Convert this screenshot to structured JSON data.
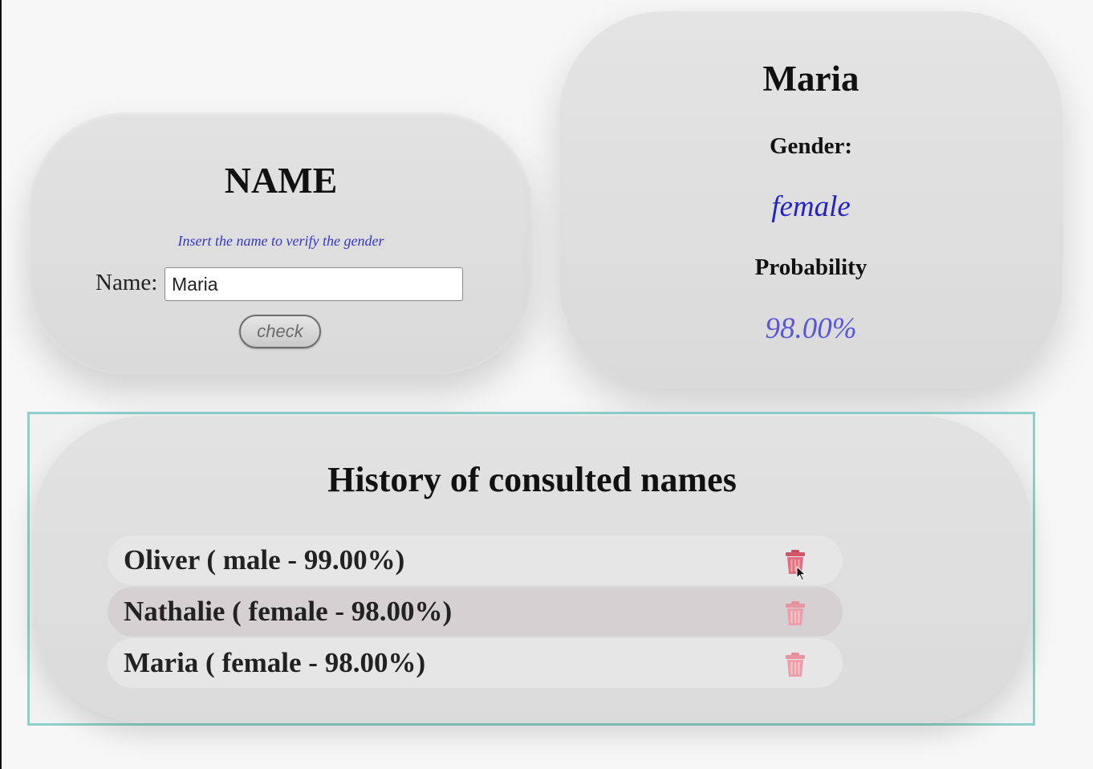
{
  "name_form": {
    "title": "NAME",
    "hint": "Insert the name to verify the gender",
    "label": "Name:",
    "input_value": "Maria",
    "button_label": "check"
  },
  "result": {
    "name": "Maria",
    "gender_label": "Gender:",
    "gender": "female",
    "probability_label": "Probability",
    "probability": "98.00%"
  },
  "history": {
    "title": "History of consulted names",
    "items": [
      {
        "text": "Oliver ( male - 99.00%)",
        "icon": "trash-icon"
      },
      {
        "text": "Nathalie ( female - 98.00%)",
        "icon": "trash-icon"
      },
      {
        "text": "Maria ( female - 98.00%)",
        "icon": "trash-icon"
      }
    ]
  },
  "colors": {
    "accent_blue": "#2323c4",
    "probability_blue": "#5b55d8",
    "frame_teal": "#8fcfc9",
    "trash_red": "#e06f7f"
  }
}
